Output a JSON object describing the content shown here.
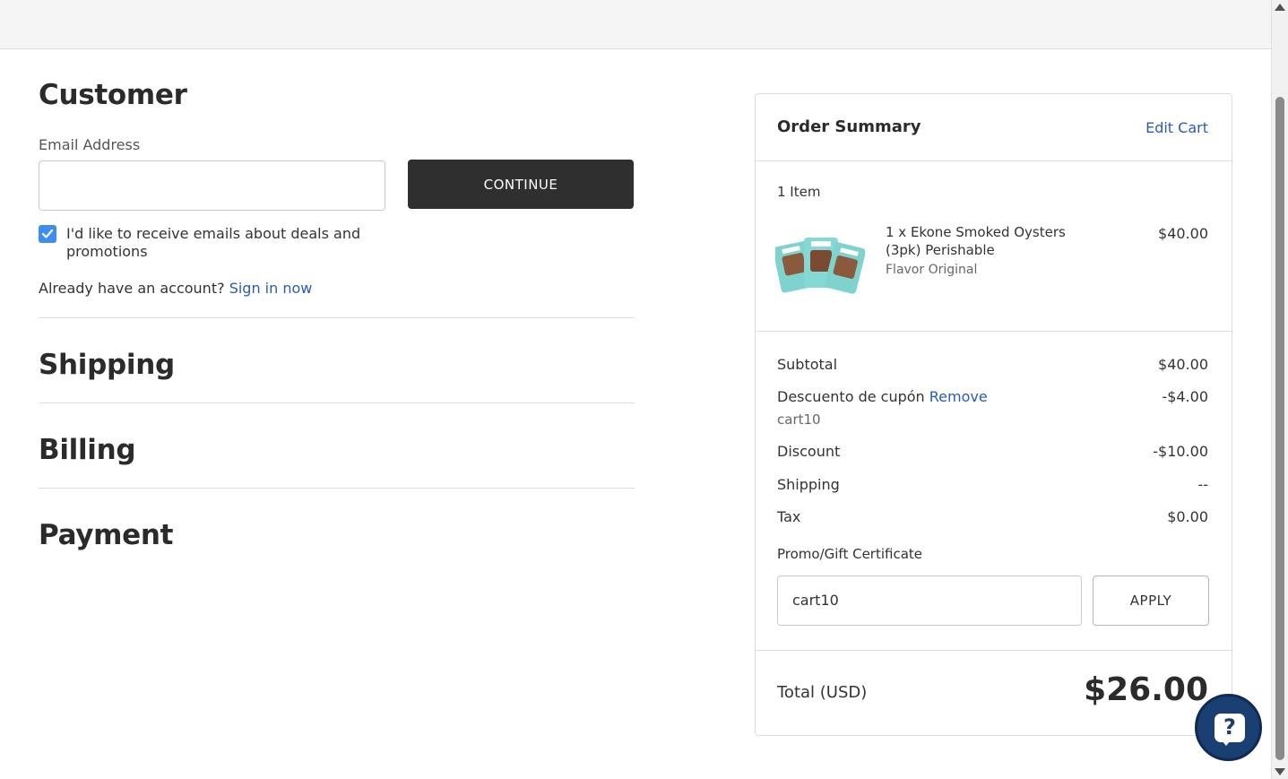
{
  "customer": {
    "heading": "Customer",
    "email_label": "Email Address",
    "email_value": "",
    "continue_label": "CONTINUE",
    "newsletter_label": "I'd like to receive emails about deals and promotions",
    "newsletter_checked": true,
    "account_prompt": "Already have an account?",
    "signin_label": "Sign in now"
  },
  "sections": {
    "shipping": "Shipping",
    "billing": "Billing",
    "payment": "Payment"
  },
  "summary": {
    "title": "Order Summary",
    "edit_cart": "Edit Cart",
    "item_count": "1 Item",
    "item": {
      "name": "1 x Ekone Smoked Oysters (3pk) Perishable",
      "option": "Flavor Original",
      "price": "$40.00"
    },
    "subtotal_label": "Subtotal",
    "subtotal_value": "$40.00",
    "coupon_label": "Descuento de cupón",
    "coupon_remove": "Remove",
    "coupon_code": "cart10",
    "coupon_value": "-$4.00",
    "discount_label": "Discount",
    "discount_value": "-$10.00",
    "shipping_label": "Shipping",
    "shipping_value": "--",
    "tax_label": "Tax",
    "tax_value": "$0.00",
    "promo_label": "Promo/Gift Certificate",
    "promo_value": "cart10",
    "apply_label": "APPLY",
    "total_label": "Total (USD)",
    "total_value": "$26.00"
  },
  "help": {
    "icon": "help-question-icon",
    "glyph": "?"
  },
  "colors": {
    "link": "#2a5bb5",
    "button_dark": "#2f2f2f",
    "checkbox": "#3e8ef0",
    "help_button": "#1a3f73"
  }
}
